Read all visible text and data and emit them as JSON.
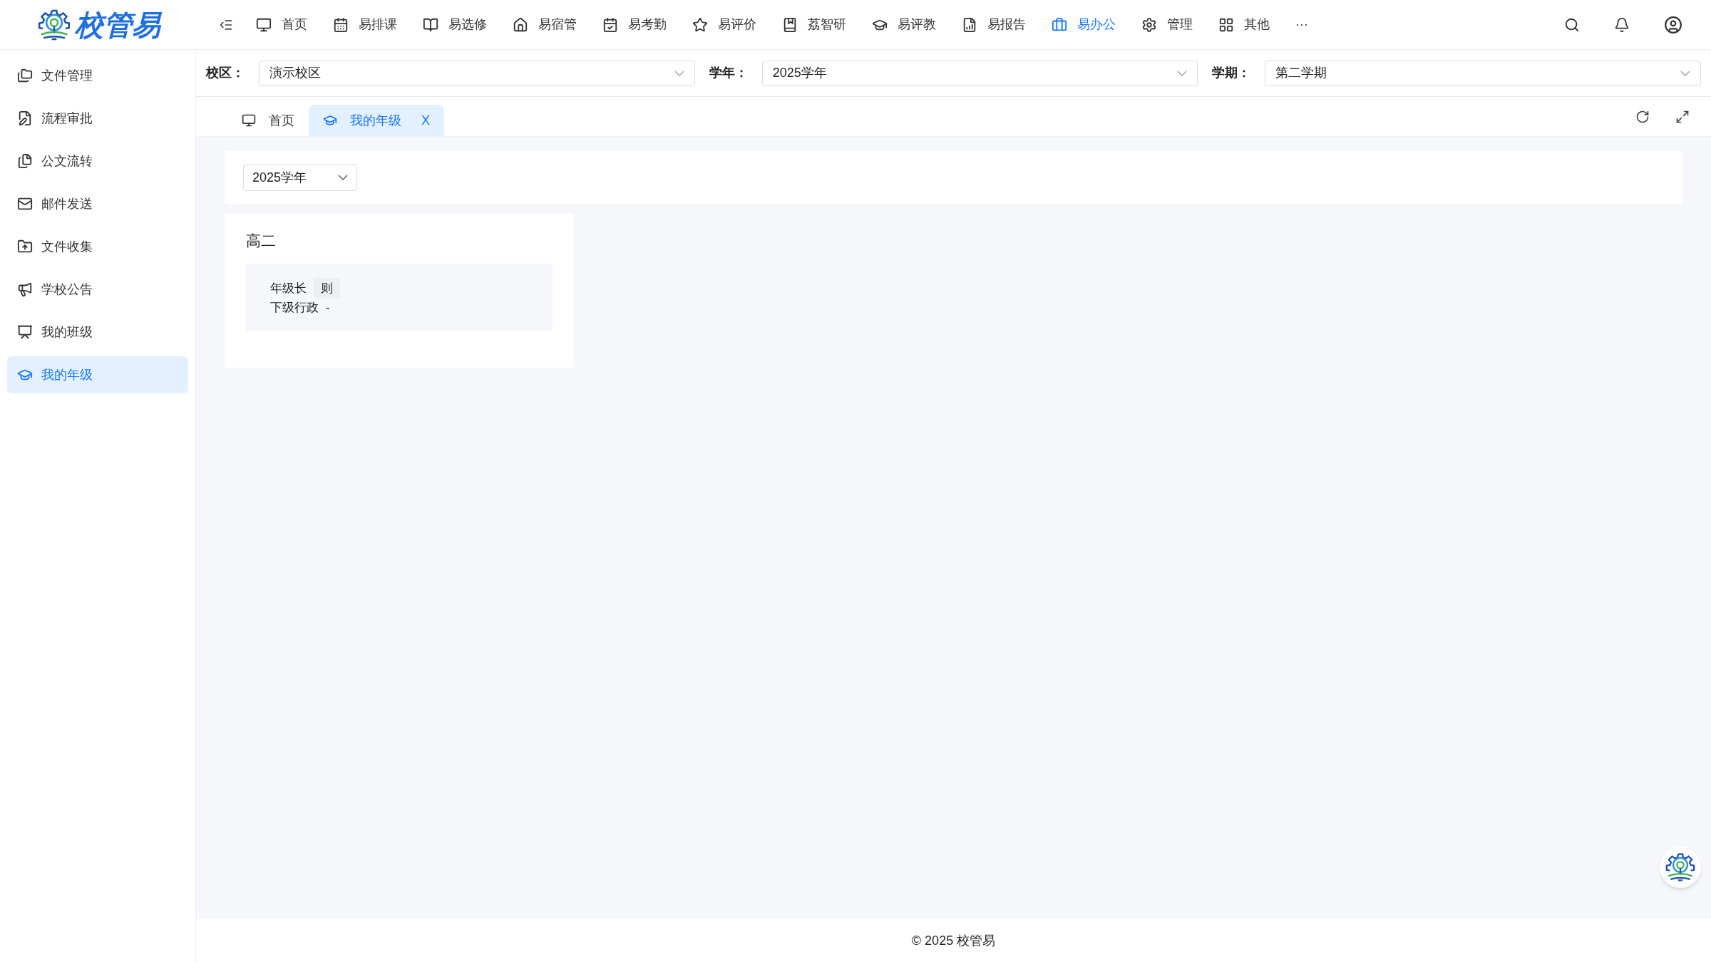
{
  "logo": {
    "text": "校管易"
  },
  "nav": [
    {
      "label": "首页",
      "selected": false
    },
    {
      "label": "易排课",
      "selected": false
    },
    {
      "label": "易选修",
      "selected": false
    },
    {
      "label": "易宿管",
      "selected": false
    },
    {
      "label": "易考勤",
      "selected": false
    },
    {
      "label": "易评价",
      "selected": false
    },
    {
      "label": "荔智研",
      "selected": false
    },
    {
      "label": "易评教",
      "selected": false
    },
    {
      "label": "易报告",
      "selected": false
    },
    {
      "label": "易办公",
      "selected": true
    },
    {
      "label": "管理",
      "selected": false
    },
    {
      "label": "其他",
      "selected": false
    }
  ],
  "nav_more": "···",
  "sidebar": {
    "items": [
      {
        "label": "文件管理",
        "selected": false
      },
      {
        "label": "流程审批",
        "selected": false
      },
      {
        "label": "公文流转",
        "selected": false
      },
      {
        "label": "邮件发送",
        "selected": false
      },
      {
        "label": "文件收集",
        "selected": false
      },
      {
        "label": "学校公告",
        "selected": false
      },
      {
        "label": "我的班级",
        "selected": false
      },
      {
        "label": "我的年级",
        "selected": true
      }
    ]
  },
  "filters": [
    {
      "label": "校区：",
      "value": "演示校区"
    },
    {
      "label": "学年：",
      "value": "2025学年"
    },
    {
      "label": "学期：",
      "value": "第二学期"
    }
  ],
  "tabs": [
    {
      "label": "首页",
      "selected": false
    },
    {
      "label": "我的年级",
      "selected": true
    }
  ],
  "tab_close": "X",
  "year_select": {
    "value": "2025学年"
  },
  "grades": [
    {
      "title": "高二",
      "rows": [
        {
          "label": "年级长",
          "value": "则",
          "kind": "tag"
        },
        {
          "label": "下级行政",
          "value": "-",
          "kind": "plain"
        }
      ]
    }
  ],
  "footer": "© 2025 校管易"
}
